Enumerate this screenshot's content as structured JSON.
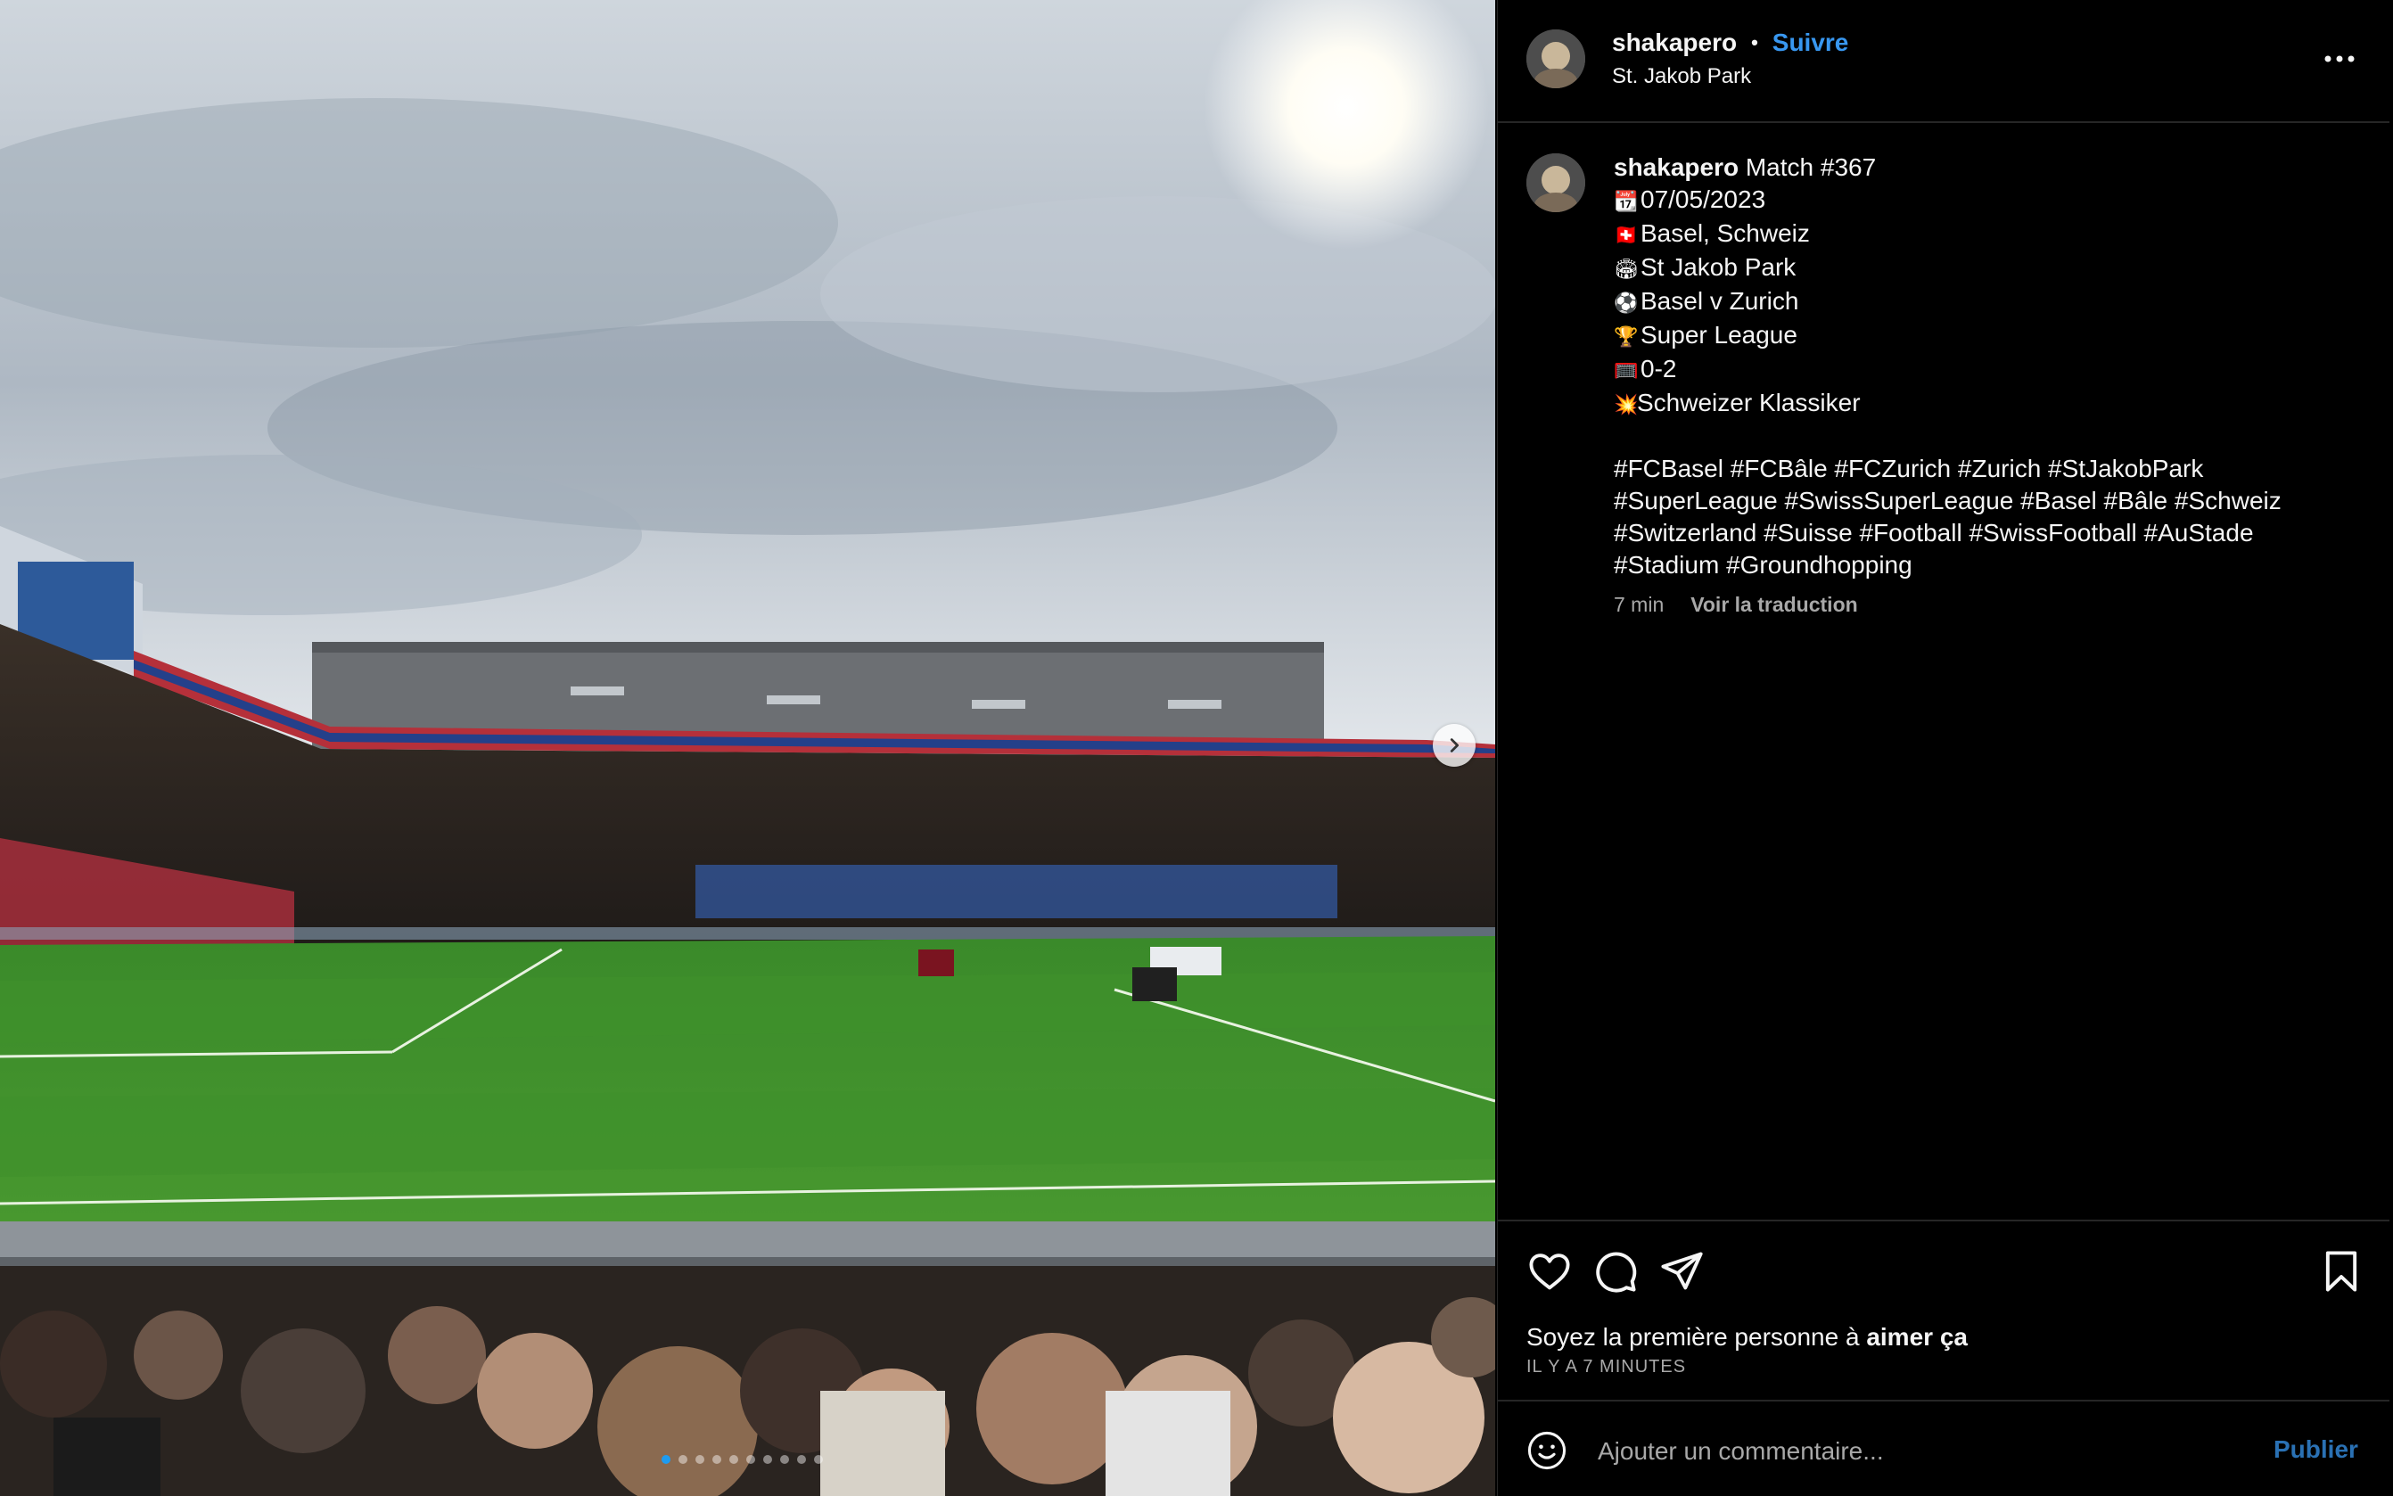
{
  "post": {
    "username": "shakapero",
    "separator": "•",
    "follow_label": "Suivre",
    "location": "St. Jakob Park",
    "more_icon": "more-horizontal-icon"
  },
  "caption": {
    "username": "shakapero",
    "lines": [
      {
        "icon": "📆",
        "text": "Match #367"
      },
      {
        "icon": "📆",
        "text": "07/05/2023"
      },
      {
        "icon": "🇨🇭",
        "text": "Basel, Schweiz"
      },
      {
        "icon": "🏟",
        "text": "St Jakob Park"
      },
      {
        "icon": "⚽",
        "text": "Basel v Zurich"
      },
      {
        "icon": "🏆",
        "text": "Super League"
      },
      {
        "icon": "🥅",
        "text": "0-2"
      },
      {
        "icon": "💥",
        "text": "Schweizer Klassiker"
      }
    ],
    "hashtags": [
      "#FCBasel #FCBâle #FCZurich #Zurich #StJakobPark",
      "#SuperLeague #SwissSuperLeague #Basel #Bâle #Schweiz",
      "#Switzerland #Suisse #Football #SwissFootball #AuStade",
      "#Stadium #Groundhopping"
    ],
    "time": "7 min",
    "translate_label": "Voir la traduction"
  },
  "actions": {
    "likes_prefix": "Soyez la première personne à ",
    "likes_strong": "aimer ça",
    "time_ago": "IL Y A 7 MINUTES",
    "comment_placeholder": "Ajouter un commentaire...",
    "publish_label": "Publier"
  },
  "carousel": {
    "slide_count": 10,
    "active_index": 0
  },
  "colors": {
    "accent": "#3897f0",
    "background": "#000000",
    "muted": "#a8a8a8",
    "divider": "#262626"
  }
}
